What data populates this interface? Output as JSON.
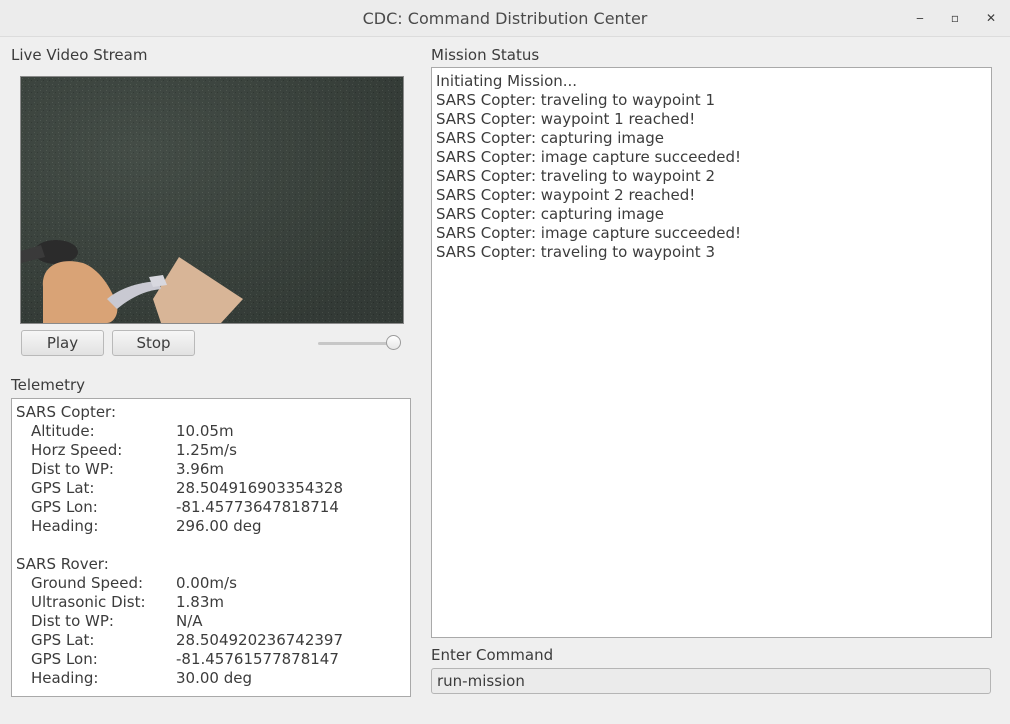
{
  "window": {
    "title": "CDC: Command Distribution Center",
    "minimize_glyph": "‒",
    "maximize_glyph": "▫",
    "close_glyph": "✕"
  },
  "video": {
    "label": "Live Video Stream",
    "play_label": "Play",
    "stop_label": "Stop",
    "volume_level": 1.0
  },
  "telemetry": {
    "label": "Telemetry",
    "copter": {
      "heading": "SARS Copter:",
      "rows": [
        {
          "key": "Altitude:",
          "value": "10.05m"
        },
        {
          "key": "Horz Speed:",
          "value": "1.25m/s"
        },
        {
          "key": "Dist to WP:",
          "value": "3.96m"
        },
        {
          "key": "GPS Lat:",
          "value": "28.504916903354328"
        },
        {
          "key": "GPS Lon:",
          "value": "-81.45773647818714"
        },
        {
          "key": "Heading:",
          "value": "296.00 deg"
        }
      ]
    },
    "rover": {
      "heading": "SARS Rover:",
      "rows": [
        {
          "key": "Ground Speed:",
          "value": "0.00m/s"
        },
        {
          "key": "Ultrasonic Dist:",
          "value": "1.83m"
        },
        {
          "key": "Dist to WP:",
          "value": "N/A"
        },
        {
          "key": "GPS Lat:",
          "value": "28.504920236742397"
        },
        {
          "key": "GPS Lon:",
          "value": "-81.45761577878147"
        },
        {
          "key": "Heading:",
          "value": "30.00 deg"
        }
      ]
    }
  },
  "mission": {
    "label": "Mission Status",
    "lines": [
      "Initiating Mission...",
      "SARS Copter: traveling to waypoint 1",
      "SARS Copter: waypoint 1 reached!",
      "SARS Copter: capturing image",
      "SARS Copter: image capture succeeded!",
      "SARS Copter: traveling to waypoint 2",
      "SARS Copter: waypoint 2 reached!",
      "SARS Copter: capturing image",
      "SARS Copter: image capture succeeded!",
      "SARS Copter: traveling to waypoint 3"
    ]
  },
  "command": {
    "label": "Enter Command",
    "value": "run-mission"
  }
}
